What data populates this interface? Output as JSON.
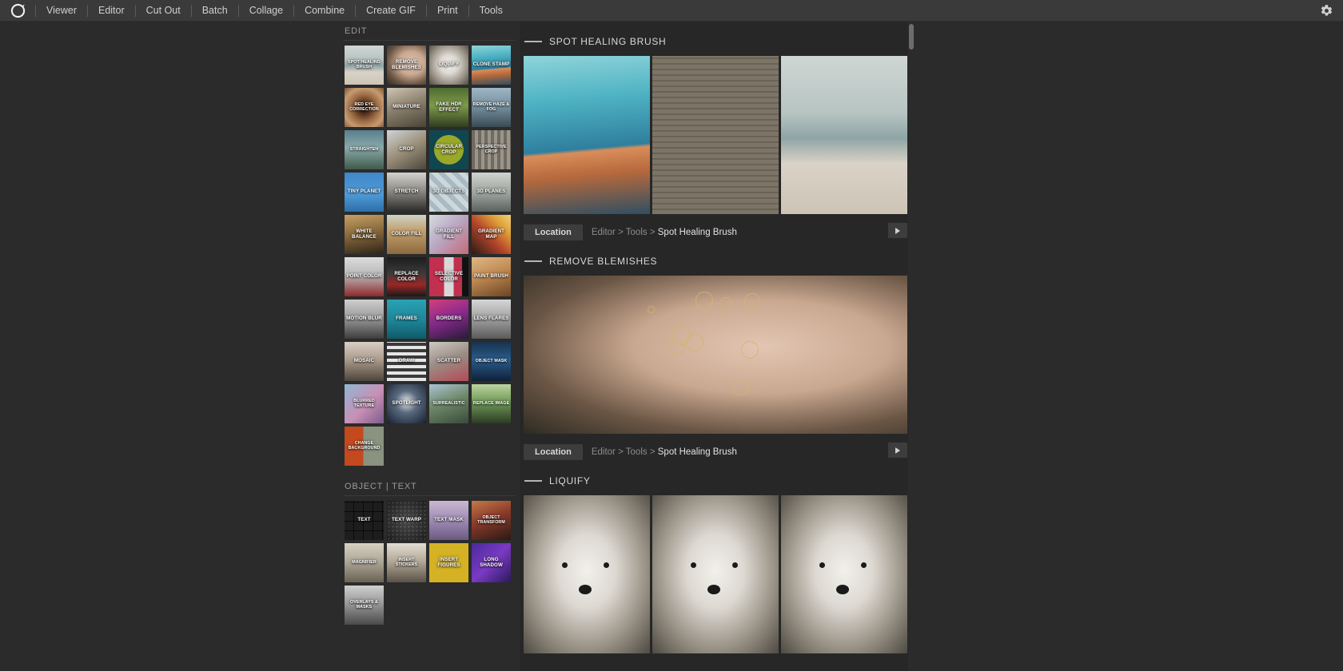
{
  "app": {
    "logo_icon": "app-logo-icon",
    "settings_icon": "gear-icon"
  },
  "menubar": {
    "items": [
      {
        "label": "Viewer"
      },
      {
        "label": "Editor"
      },
      {
        "label": "Cut Out"
      },
      {
        "label": "Batch"
      },
      {
        "label": "Collage"
      },
      {
        "label": "Combine"
      },
      {
        "label": "Create GIF"
      },
      {
        "label": "Print"
      },
      {
        "label": "Tools"
      }
    ]
  },
  "left_panel": {
    "sections": [
      {
        "label": "EDIT",
        "tiles": [
          {
            "label": "SPOT HEALING BRUSH",
            "art": "img-beach",
            "small": true
          },
          {
            "label": "REMOVE BLEMISHES",
            "art": "img-face"
          },
          {
            "label": "LIQUIFY",
            "art": "img-fox"
          },
          {
            "label": "CLONE STAMP",
            "art": "img-pool"
          },
          {
            "label": "RED EYE CORRECTION",
            "art": "img-eye",
            "small": true
          },
          {
            "label": "MINIATURE",
            "art": "img-mini"
          },
          {
            "label": "FAKE HDR EFFECT",
            "art": "img-hdr"
          },
          {
            "label": "REMOVE HAZE & FOG",
            "art": "img-haze",
            "small": true
          },
          {
            "label": "STRAIGHTEN",
            "art": "img-straight",
            "small": true
          },
          {
            "label": "CROP",
            "art": "img-crop"
          },
          {
            "label": "CIRCULAR CROP",
            "art": "img-circ"
          },
          {
            "label": "PERSPECTIVE CROP",
            "art": "img-persp",
            "small": true
          },
          {
            "label": "TINY PLANET",
            "art": "img-tiny"
          },
          {
            "label": "STRETCH",
            "art": "img-stretch"
          },
          {
            "label": "3D OBJECTS",
            "art": "img-3do"
          },
          {
            "label": "3D PLANES",
            "art": "img-3dp"
          },
          {
            "label": "WHITE BALANCE",
            "art": "img-wb"
          },
          {
            "label": "COLOR FILL",
            "art": "img-cfill"
          },
          {
            "label": "GRADIENT FILL",
            "art": "img-gfill"
          },
          {
            "label": "GRADIENT MAP",
            "art": "img-gmap"
          },
          {
            "label": "POINT COLOR",
            "art": "img-pcolor"
          },
          {
            "label": "REPLACE COLOR",
            "art": "img-rcolor"
          },
          {
            "label": "SELECTIVE COLOR",
            "art": "img-scolor"
          },
          {
            "label": "PAINT BRUSH",
            "art": "img-pbrush"
          },
          {
            "label": "MOTION BLUR",
            "art": "img-mblur"
          },
          {
            "label": "FRAMES",
            "art": "img-frames"
          },
          {
            "label": "BORDERS",
            "art": "img-borders"
          },
          {
            "label": "LENS FLARES",
            "art": "img-lens"
          },
          {
            "label": "MOSAIC",
            "art": "img-mosaic"
          },
          {
            "label": "DRAW",
            "art": "img-draw"
          },
          {
            "label": "SCATTER",
            "art": "img-scatter"
          },
          {
            "label": "OBJECT MASK",
            "art": "img-omask",
            "small": true
          },
          {
            "label": "BLURRED TEXTURE",
            "art": "img-btex",
            "small": true
          },
          {
            "label": "SPOTLIGHT",
            "art": "img-spot"
          },
          {
            "label": "SURREALISTIC",
            "art": "img-surr",
            "small": true
          },
          {
            "label": "REPLACE IMAGE",
            "art": "img-rimg",
            "small": true
          },
          {
            "label": "CHANGE BACKGROUND",
            "art": "img-chbg",
            "small": true
          }
        ]
      },
      {
        "label": "OBJECT | TEXT",
        "tiles": [
          {
            "label": "TEXT",
            "art": "img-text"
          },
          {
            "label": "TEXT WARP",
            "art": "img-twarp"
          },
          {
            "label": "TEXT MASK",
            "art": "img-tmask"
          },
          {
            "label": "OBJECT TRANSFORM",
            "art": "img-otr",
            "small": true
          },
          {
            "label": "MAGNIFIER",
            "art": "img-mag",
            "small": true
          },
          {
            "label": "INSERT STICKERS",
            "art": "img-stick",
            "small": true
          },
          {
            "label": "INSERT FIGURES",
            "art": "img-figs"
          },
          {
            "label": "LONG SHADOW",
            "art": "img-lshad"
          },
          {
            "label": "OVERLAYS & MASKS",
            "art": "img-overl",
            "small": true
          }
        ]
      }
    ]
  },
  "content": {
    "sections": [
      {
        "title": "SPOT HEALING BRUSH",
        "media_kind": "triple",
        "media": [
          "img-pool",
          "img-wall",
          "img-beach"
        ],
        "location": {
          "button_label": "Location",
          "crumb_prefix": "Editor > Tools > ",
          "crumb_current": "Spot Healing Brush",
          "play_icon": "play-icon"
        }
      },
      {
        "title": "REMOVE BLEMISHES",
        "media_kind": "single",
        "media": [
          "img-face"
        ],
        "location": {
          "button_label": "Location",
          "crumb_prefix": "Editor > Tools > ",
          "crumb_current": "Spot Healing Brush",
          "play_icon": "play-icon"
        }
      },
      {
        "title": "LIQUIFY",
        "media_kind": "triple",
        "media": [
          "img-fox",
          "img-fox",
          "img-fox"
        ],
        "location": null
      }
    ]
  },
  "scrollbar": {
    "name": "content-scrollbar"
  },
  "colors": {
    "menubar_bg": "#3a3a3a",
    "panel_bg": "#2b2b2b",
    "content_bg": "#272727",
    "text": "#cfcfcf",
    "pill_bg": "#3d3d3d",
    "accent_selected": "#3f87c9"
  }
}
